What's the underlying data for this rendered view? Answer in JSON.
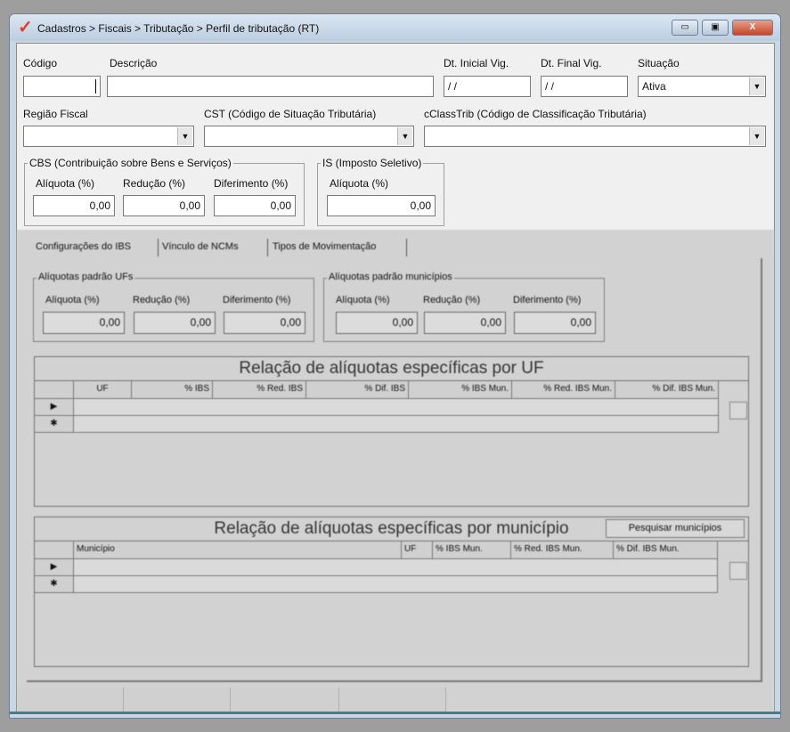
{
  "window": {
    "title": "Cadastros > Fiscais > Tributação > Perfil de tributação (RT)",
    "minimize": "▭",
    "maximize": "▣",
    "close": "X"
  },
  "form": {
    "codigo_label": "Código",
    "codigo_value": "",
    "descricao_label": "Descrição",
    "descricao_value": "",
    "dt_inicial_label": "Dt. Inicial Vig.",
    "dt_inicial_value": "/ /",
    "dt_final_label": "Dt. Final Vig.",
    "dt_final_value": "/ /",
    "situacao_label": "Situação",
    "situacao_value": "Ativa",
    "regiao_label": "Região Fiscal",
    "regiao_value": "",
    "cst_label": "CST (Código de Situação Tributária)",
    "cst_value": "",
    "cclass_label": "cClassTrib (Código de Classificação Tributária)",
    "cclass_value": ""
  },
  "cbs": {
    "title": "CBS (Contribuição sobre Bens e Serviços)",
    "aliquota_label": "Alíquota (%)",
    "aliquota": "0,00",
    "reducao_label": "Redução (%)",
    "reducao": "0,00",
    "diferimento_label": "Diferimento (%)",
    "diferimento": "0,00"
  },
  "is": {
    "title": "IS (Imposto Seletivo)",
    "aliquota_label": "Alíquota (%)",
    "aliquota": "0,00"
  },
  "tabs": [
    "Configurações do IBS",
    "Vínculo de NCMs",
    "Tipos de Movimentação"
  ],
  "ufs": {
    "title": "Alíquotas padrão UFs",
    "aliquota_label": "Alíquota (%)",
    "aliquota": "0,00",
    "reducao_label": "Redução (%)",
    "reducao": "0,00",
    "diferimento_label": "Diferimento (%)",
    "diferimento": "0,00"
  },
  "municipios": {
    "title": "Alíquotas padrão municípios",
    "aliquota_label": "Alíquota (%)",
    "aliquota": "0,00",
    "reducao_label": "Redução (%)",
    "reducao": "0,00",
    "diferimento_label": "Diferimento (%)",
    "diferimento": "0,00"
  },
  "grid_uf": {
    "title": "Relação de alíquotas específicas por UF",
    "columns": [
      "UF",
      "% IBS",
      "% Red. IBS",
      "% Dif. IBS",
      "% IBS Mun.",
      "% Red. IBS Mun.",
      "% Dif. IBS Mun."
    ],
    "row_markers": [
      "▶",
      "✱"
    ]
  },
  "grid_mun": {
    "title": "Relação de alíquotas específicas por município",
    "search_button": "Pesquisar municípios",
    "columns": [
      "Município",
      "UF",
      "% IBS Mun.",
      "% Red. IBS Mun.",
      "% Dif. IBS Mun."
    ],
    "row_markers": [
      "▶",
      "✱"
    ]
  }
}
